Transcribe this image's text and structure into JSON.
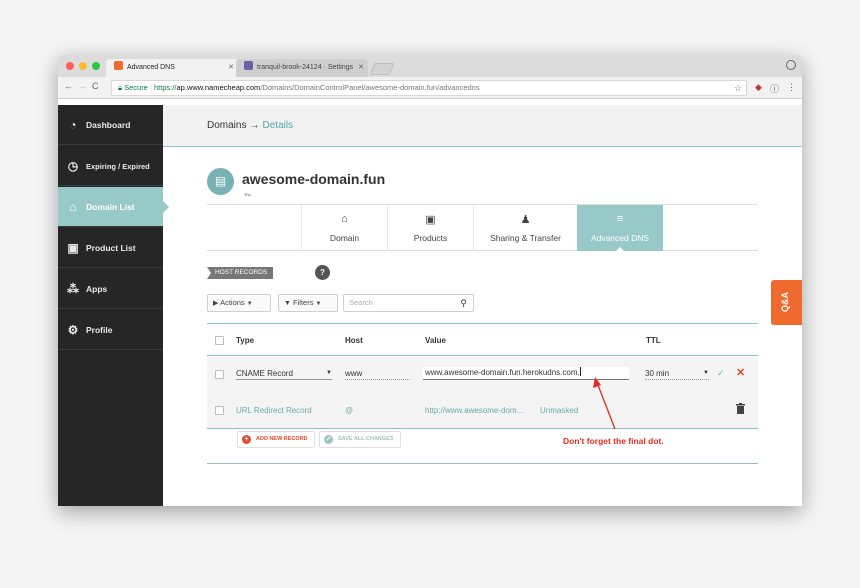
{
  "browser": {
    "tabs": [
      {
        "title": "Advanced DNS",
        "favicon_color": "#ef6a2d",
        "active": true
      },
      {
        "title": "tranquil-brook-24124 · Settings",
        "favicon_color": "#6b5fa8",
        "active": false
      }
    ],
    "secure_label": "Secure",
    "url_scheme": "https://",
    "url_host": "ap.www.namecheap.com",
    "url_path": "/Domains/DomainControlPanel/awesome-domain.fun/advancedns"
  },
  "sidebar": {
    "items": [
      {
        "label": "Dashboard",
        "icon": "gauge-icon",
        "active": false
      },
      {
        "label": "Expiring / Expired",
        "icon": "timer-icon",
        "active": false
      },
      {
        "label": "Domain List",
        "icon": "home-icon",
        "active": true
      },
      {
        "label": "Product List",
        "icon": "box-icon",
        "active": false
      },
      {
        "label": "Apps",
        "icon": "apps-icon",
        "active": false
      },
      {
        "label": "Profile",
        "icon": "gear-icon",
        "active": false
      }
    ]
  },
  "header": {
    "breadcrumb_root": "Domains",
    "breadcrumb_sep": "→",
    "breadcrumb_current": "Details"
  },
  "domain": {
    "name": "awesome-domain.fun",
    "tabs": [
      {
        "label": "Domain",
        "icon": "home-icon",
        "active": false
      },
      {
        "label": "Products",
        "icon": "box-icon",
        "active": false
      },
      {
        "label": "Sharing & Transfer",
        "icon": "users-icon",
        "active": false
      },
      {
        "label": "Advanced DNS",
        "icon": "server-icon",
        "active": true
      }
    ]
  },
  "host_records": {
    "section_label": "HOST RECORDS",
    "help_label": "?",
    "actions_label": "Actions",
    "filters_label": "Filters",
    "search_placeholder": "Search",
    "columns": {
      "type": "Type",
      "host": "Host",
      "value": "Value",
      "ttl": "TTL"
    },
    "rows": [
      {
        "type": "CNAME Record",
        "host": "www",
        "value": "www.awesome-domain.fun.herokudns.com.",
        "ttl": "30 min"
      },
      {
        "type": "URL Redirect Record",
        "host": "@",
        "value": "http://www.awesome-dom...",
        "ttl": "Unmasked"
      }
    ],
    "add_label": "ADD NEW RECORD",
    "save_label": "SAVE ALL CHANGES"
  },
  "annotation": "Don't forget the final dot.",
  "qa_label": "Q&A",
  "colors": {
    "accent": "#97c9c8",
    "sidebar": "#262626",
    "alert_red": "#e02e1f",
    "qa_orange": "#ef6a2d"
  }
}
